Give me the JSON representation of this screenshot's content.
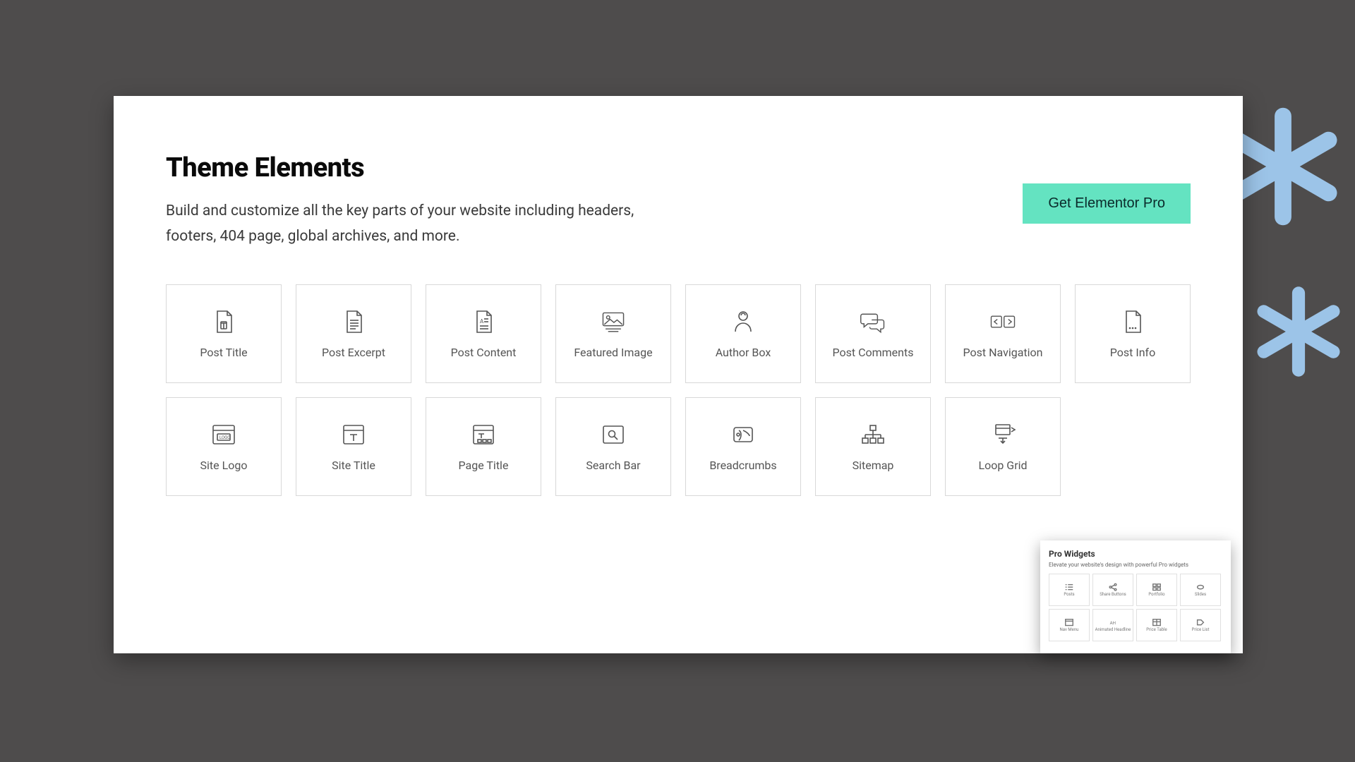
{
  "header": {
    "title": "Theme Elements",
    "subtitle": "Build and customize all the key parts of your website including headers, footers, 404 page, global archives, and more.",
    "cta_label": "Get Elementor Pro"
  },
  "widgets": [
    {
      "label": "Post Title",
      "icon": "file-t"
    },
    {
      "label": "Post Excerpt",
      "icon": "file-lines"
    },
    {
      "label": "Post Content",
      "icon": "file-content"
    },
    {
      "label": "Featured Image",
      "icon": "image"
    },
    {
      "label": "Author Box",
      "icon": "person"
    },
    {
      "label": "Post Comments",
      "icon": "chat"
    },
    {
      "label": "Post Navigation",
      "icon": "nav-arrows"
    },
    {
      "label": "Post Info",
      "icon": "file-dots"
    },
    {
      "label": "Site Logo",
      "icon": "logo"
    },
    {
      "label": "Site Title",
      "icon": "window-t"
    },
    {
      "label": "Page Title",
      "icon": "window-tt"
    },
    {
      "label": "Search Bar",
      "icon": "search"
    },
    {
      "label": "Breadcrumbs",
      "icon": "breadcrumb"
    },
    {
      "label": "Sitemap",
      "icon": "sitemap"
    },
    {
      "label": "Loop Grid",
      "icon": "loop"
    }
  ],
  "mini_panel": {
    "title": "Pro Widgets",
    "subtitle": "Elevate your website's design with powerful Pro widgets",
    "items": [
      {
        "label": "Posts"
      },
      {
        "label": "Share Buttons"
      },
      {
        "label": "Portfolio"
      },
      {
        "label": "Slides"
      },
      {
        "label": "Nav Menu"
      },
      {
        "label": "Animated Headline"
      },
      {
        "label": "Price Table"
      },
      {
        "label": "Price List"
      }
    ]
  }
}
